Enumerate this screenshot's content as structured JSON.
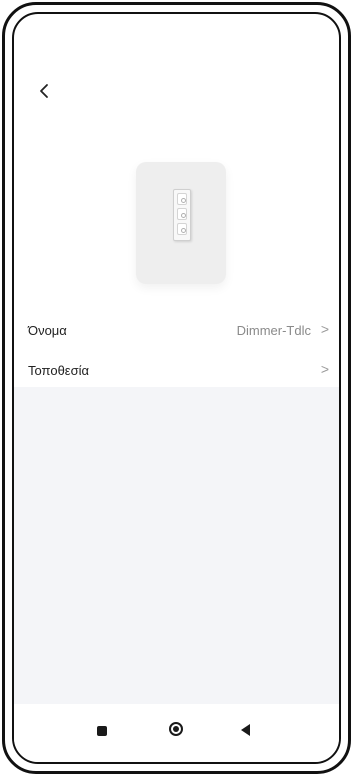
{
  "header": {
    "back_icon": "chevron-left-icon"
  },
  "device": {
    "image_icon": "dimmer-switch-icon"
  },
  "settings": {
    "rows": [
      {
        "label": "Όνομα",
        "value": "Dimmer-Tdlc",
        "chevron": ">"
      },
      {
        "label": "Τοποθεσία",
        "value": "",
        "chevron": ">"
      }
    ]
  },
  "nav_bar": {
    "recent_icon": "square-icon",
    "home_icon": "circle-icon",
    "back_icon": "triangle-back-icon"
  }
}
